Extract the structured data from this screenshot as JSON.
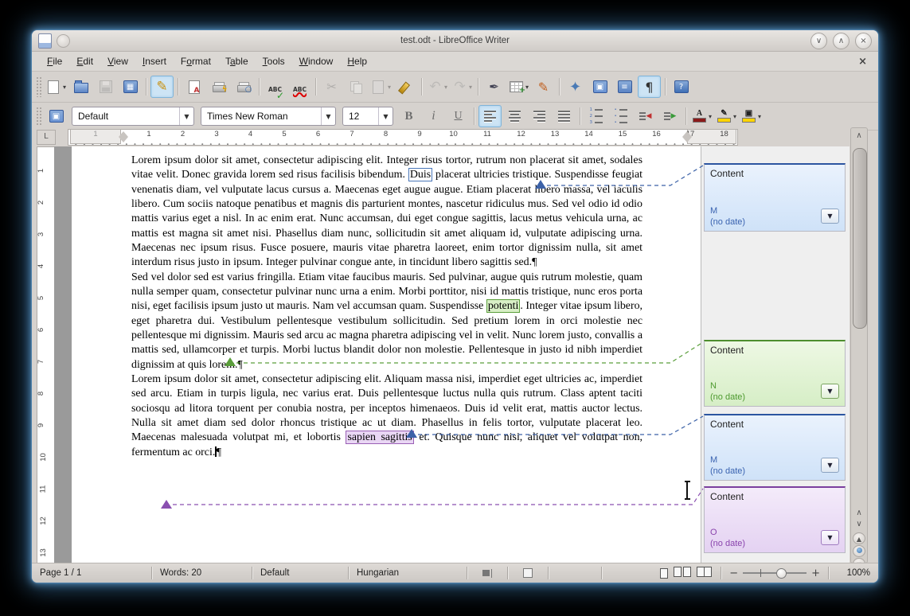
{
  "window": {
    "title": "test.odt - LibreOffice Writer",
    "controls": [
      {
        "name": "minimize",
        "glyph": "∨"
      },
      {
        "name": "maximize",
        "glyph": "∧"
      },
      {
        "name": "close",
        "glyph": "×"
      }
    ],
    "doc_close_glyph": "×"
  },
  "menubar": {
    "items": [
      {
        "label": "File",
        "accel": "F"
      },
      {
        "label": "Edit",
        "accel": "E"
      },
      {
        "label": "View",
        "accel": "V"
      },
      {
        "label": "Insert",
        "accel": "I"
      },
      {
        "label": "Format",
        "accel": "o"
      },
      {
        "label": "Table",
        "accel": "a"
      },
      {
        "label": "Tools",
        "accel": "T"
      },
      {
        "label": "Window",
        "accel": "W"
      },
      {
        "label": "Help",
        "accel": "H"
      }
    ]
  },
  "toolbar_standard": {
    "buttons": [
      {
        "name": "new-document",
        "dropdown": true
      },
      {
        "name": "open"
      },
      {
        "name": "save",
        "disabled": true
      },
      {
        "name": "email-document"
      },
      {
        "sep": true
      },
      {
        "name": "edit-file",
        "active": true
      },
      {
        "sep": true
      },
      {
        "name": "export-pdf"
      },
      {
        "name": "print-direct"
      },
      {
        "name": "page-preview"
      },
      {
        "sep": true
      },
      {
        "name": "spellcheck"
      },
      {
        "name": "auto-spellcheck"
      },
      {
        "sep": true
      },
      {
        "name": "cut",
        "disabled": true
      },
      {
        "name": "copy",
        "disabled": true
      },
      {
        "name": "paste",
        "disabled": true,
        "dropdown": true
      },
      {
        "name": "clone-formatting"
      },
      {
        "sep": true
      },
      {
        "name": "undo",
        "disabled": true,
        "dropdown": true
      },
      {
        "name": "redo",
        "disabled": true,
        "dropdown": true
      },
      {
        "sep": true
      },
      {
        "name": "hyperlink"
      },
      {
        "name": "insert-table",
        "dropdown": true
      },
      {
        "name": "draw-functions"
      },
      {
        "sep": true
      },
      {
        "name": "find-replace"
      },
      {
        "name": "navigator"
      },
      {
        "name": "gallery"
      },
      {
        "name": "formatting-marks",
        "active": true
      },
      {
        "sep": true
      },
      {
        "name": "help"
      }
    ]
  },
  "toolbar_formatting": {
    "paragraph_style": "Default",
    "font_name": "Times New Roman",
    "font_size": "12",
    "buttons": [
      {
        "name": "bold"
      },
      {
        "name": "italic"
      },
      {
        "name": "underline"
      },
      {
        "sep": true
      },
      {
        "name": "align-left",
        "active": true
      },
      {
        "name": "align-center"
      },
      {
        "name": "align-right"
      },
      {
        "name": "justify"
      },
      {
        "sep": true
      },
      {
        "name": "numbered-list"
      },
      {
        "name": "bullet-list"
      },
      {
        "name": "decrease-indent"
      },
      {
        "name": "increase-indent"
      },
      {
        "sep": true
      },
      {
        "name": "font-color",
        "dropdown": true
      },
      {
        "name": "highlight-color",
        "dropdown": true
      },
      {
        "name": "background-color",
        "dropdown": true
      }
    ]
  },
  "ruler": {
    "tab_selector": "L",
    "margin_number": "1",
    "h_numbers": [
      "1",
      "2",
      "3",
      "4",
      "5",
      "6",
      "7",
      "8",
      "9",
      "10",
      "11",
      "12",
      "13",
      "14",
      "15",
      "16",
      "17",
      "18"
    ],
    "v_numbers": [
      "1",
      "2",
      "3",
      "4",
      "5",
      "6",
      "7",
      "8",
      "9",
      "10",
      "11",
      "12",
      "13"
    ]
  },
  "document": {
    "paragraphs": [
      {
        "segments": [
          {
            "t": "Lorem ipsum dolor sit amet, consectetur adipiscing elit. Integer risus tortor, rutrum non placerat sit amet, sodales vitae velit. Donec gravida lorem sed risus facilisis bibendum. "
          },
          {
            "t": "Duis",
            "s": "anchor-blue"
          },
          {
            "t": " placerat ultricies tristique. Suspendisse feugiat venenatis diam, vel vulputate lacus cursus a. Maecenas eget augue augue. Etiam placerat libero massa, vel iaculis libero. Cum sociis natoque penatibus et magnis dis parturient montes, nascetur ridiculus mus. Sed vel odio id odio mattis varius eget a nisl. In ac enim erat. Nunc accumsan, dui eget congue sagittis, lacus metus vehicula urna, ac mattis est magna sit amet nisi. Phasellus diam nunc, sollicitudin sit amet aliquam id, vulputate adipiscing urna. Maecenas nec ipsum risus. Fusce posuere, mauris vitae pharetra laoreet, enim tortor dignissim nulla, sit amet interdum risus justo in ipsum. Integer pulvinar congue ante, in tincidunt libero sagittis sed."
          },
          {
            "t": "¶",
            "s": "pilcrow"
          }
        ]
      },
      {
        "segments": [
          {
            "t": "Sed vel dolor sed est varius fringilla. Etiam vitae faucibus mauris. Sed pulvinar, augue quis rutrum molestie, quam nulla semper quam, consectetur pulvinar nunc urna a enim. Morbi porttitor, nisi id mattis tristique, nunc eros porta nisi, eget facilisis ipsum justo ut mauris. Nam vel accumsan quam. Suspendisse "
          },
          {
            "t": "potenti",
            "s": "anchor-green"
          },
          {
            "t": ". Integer vitae ipsum libero, eget pharetra dui. Vestibulum pellentesque vestibulum sollicitudin. Sed pretium lorem in orci molestie nec pellentesque mi dignissim. Mauris sed arcu ac magna pharetra adipiscing vel in velit. Nunc lorem justo, convallis a mattis sed, ullamcorper et turpis. Morbi luctus blandit dolor non molestie. Pellentesque in justo id nibh imperdiet dignissim at quis lorem."
          },
          {
            "t": "¶",
            "s": "pilcrow"
          }
        ]
      },
      {
        "segments": [
          {
            "t": "Lorem ipsum dolor sit amet, consectetur adipiscing elit. Aliquam massa nisi, imperdiet eget ultricies ac, imperdiet sed arcu. Etiam in turpis ligula, nec varius erat. Duis pellentesque luctus nulla quis rutrum. Class aptent taciti sociosqu ad litora torquent per conubia nostra, per inceptos himenaeos. Duis id velit erat, mattis auctor lectus. Nulla sit amet diam sed dolor rhoncus tristique ac ut diam. Phasellus in felis tortor, vulputate placerat leo. Maecenas malesuada volutpat mi, et lobortis "
          },
          {
            "t": "sapien sagittis",
            "s": "anchor-purple"
          },
          {
            "t": " et. Quisque nunc nisi, aliquet vel volutpat non, fermentum ac orci."
          },
          {
            "t": "",
            "s": "caret"
          },
          {
            "t": "¶",
            "s": "pilcrow"
          }
        ]
      }
    ]
  },
  "comments": {
    "items": [
      {
        "text": "Content",
        "author": "M",
        "date": "(no date)",
        "theme": "blue"
      },
      {
        "text": "Content",
        "author": "N",
        "date": "(no date)",
        "theme": "green"
      },
      {
        "text": "Content",
        "author": "M",
        "date": "(no date)",
        "theme": "blue"
      },
      {
        "text": "Content",
        "author": "O",
        "date": "(no date)",
        "theme": "purple"
      }
    ],
    "menu_glyph": "▼"
  },
  "colors": {
    "comment_blue": "#3c62a8",
    "comment_green": "#5a9e3a",
    "comment_purple": "#8a4fb0",
    "active_button_bg": "#cde4f5"
  },
  "statusbar": {
    "page": "Page 1 / 1",
    "words": "Words: 20",
    "page_style": "Default",
    "language": "Hungarian",
    "zoom_level": "100%",
    "zoom_minus": "−",
    "zoom_plus": "+"
  },
  "scrollbar": {
    "up_glyph": "∧",
    "down_glyph": "∨"
  }
}
